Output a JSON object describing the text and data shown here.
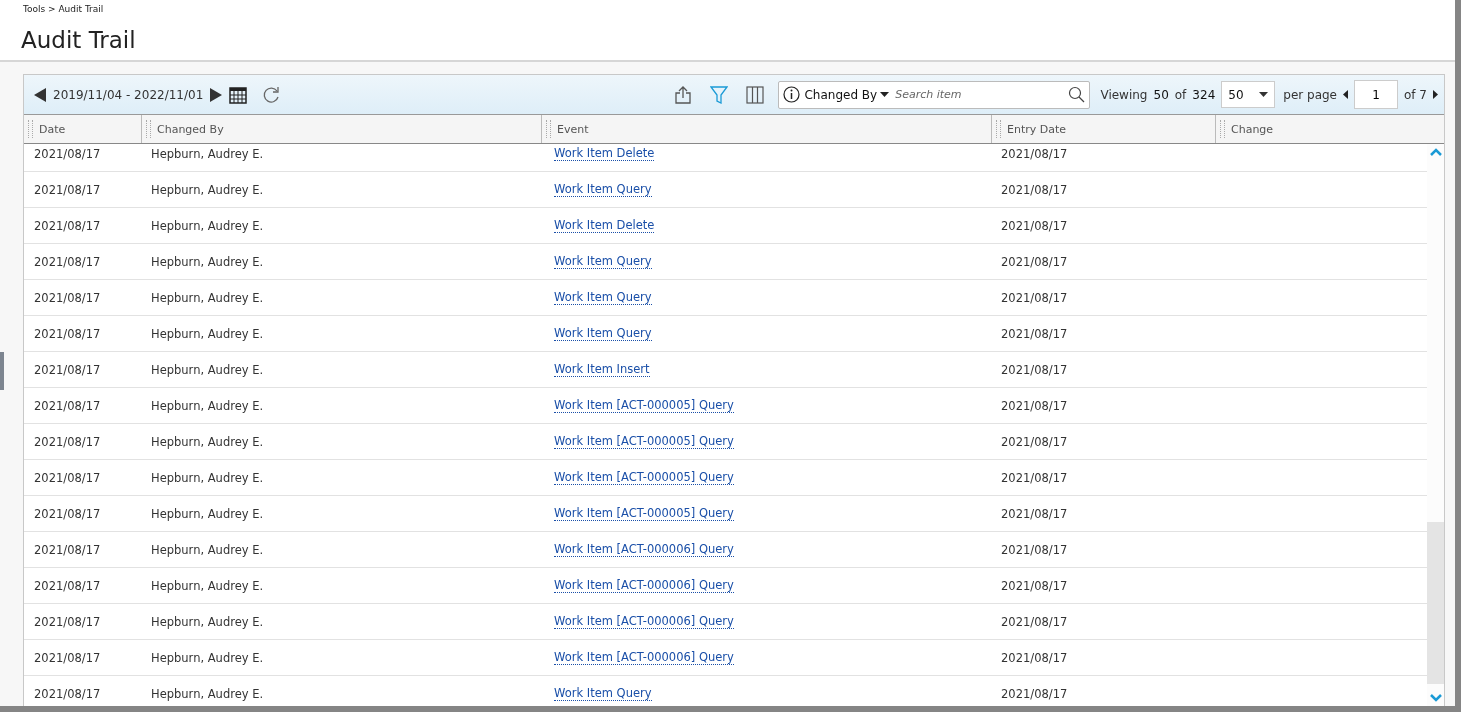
{
  "breadcrumb": "Tools > Audit Trail",
  "title": "Audit Trail",
  "toolbar": {
    "date_range": "2019/11/04 - 2022/11/01",
    "search_field": "Changed By",
    "search_placeholder": "Search item",
    "viewing_label": "Viewing",
    "viewing_count": "50",
    "viewing_of": "of",
    "viewing_total": "324",
    "page_size": "50",
    "per_page": "per page",
    "page": "1",
    "page_of": "of 7"
  },
  "table": {
    "columns": [
      "Date",
      "Changed By",
      "Event",
      "Entry Date",
      "Change"
    ],
    "rows": [
      {
        "date": "2021/08/17",
        "changed_by": "Hepburn, Audrey E.",
        "event": "Work Item Delete",
        "entry_date": "2021/08/17"
      },
      {
        "date": "2021/08/17",
        "changed_by": "Hepburn, Audrey E.",
        "event": "Work Item Query",
        "entry_date": "2021/08/17"
      },
      {
        "date": "2021/08/17",
        "changed_by": "Hepburn, Audrey E.",
        "event": "Work Item Delete",
        "entry_date": "2021/08/17"
      },
      {
        "date": "2021/08/17",
        "changed_by": "Hepburn, Audrey E.",
        "event": "Work Item Query",
        "entry_date": "2021/08/17"
      },
      {
        "date": "2021/08/17",
        "changed_by": "Hepburn, Audrey E.",
        "event": "Work Item Query",
        "entry_date": "2021/08/17"
      },
      {
        "date": "2021/08/17",
        "changed_by": "Hepburn, Audrey E.",
        "event": "Work Item Query",
        "entry_date": "2021/08/17"
      },
      {
        "date": "2021/08/17",
        "changed_by": "Hepburn, Audrey E.",
        "event": "Work Item Insert",
        "entry_date": "2021/08/17"
      },
      {
        "date": "2021/08/17",
        "changed_by": "Hepburn, Audrey E.",
        "event": "Work Item [ACT-000005] Query",
        "entry_date": "2021/08/17"
      },
      {
        "date": "2021/08/17",
        "changed_by": "Hepburn, Audrey E.",
        "event": "Work Item [ACT-000005] Query",
        "entry_date": "2021/08/17"
      },
      {
        "date": "2021/08/17",
        "changed_by": "Hepburn, Audrey E.",
        "event": "Work Item [ACT-000005] Query",
        "entry_date": "2021/08/17"
      },
      {
        "date": "2021/08/17",
        "changed_by": "Hepburn, Audrey E.",
        "event": "Work Item [ACT-000005] Query",
        "entry_date": "2021/08/17"
      },
      {
        "date": "2021/08/17",
        "changed_by": "Hepburn, Audrey E.",
        "event": "Work Item [ACT-000006] Query",
        "entry_date": "2021/08/17"
      },
      {
        "date": "2021/08/17",
        "changed_by": "Hepburn, Audrey E.",
        "event": "Work Item [ACT-000006] Query",
        "entry_date": "2021/08/17"
      },
      {
        "date": "2021/08/17",
        "changed_by": "Hepburn, Audrey E.",
        "event": "Work Item [ACT-000006] Query",
        "entry_date": "2021/08/17"
      },
      {
        "date": "2021/08/17",
        "changed_by": "Hepburn, Audrey E.",
        "event": "Work Item [ACT-000006] Query",
        "entry_date": "2021/08/17"
      },
      {
        "date": "2021/08/17",
        "changed_by": "Hepburn, Audrey E.",
        "event": "Work Item Query",
        "entry_date": "2021/08/17"
      }
    ]
  }
}
